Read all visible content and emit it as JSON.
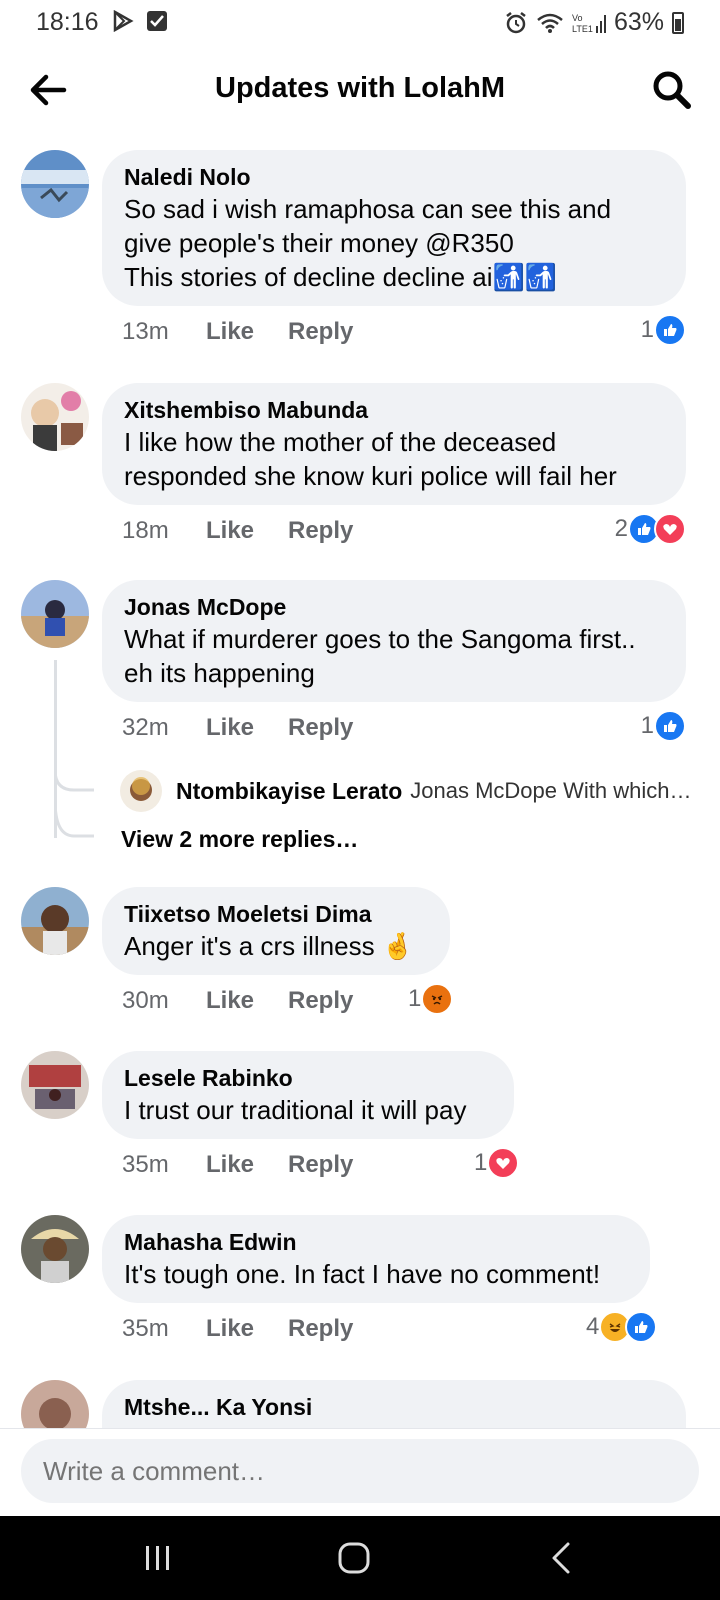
{
  "status_bar": {
    "time": "18:16",
    "battery": "63%",
    "net": "Vo\nLTE1"
  },
  "app_bar": {
    "title": "Updates with LolahM"
  },
  "comments": [
    {
      "name": "Naledi Nolo",
      "text": "So sad i wish ramaphosa can see this  and give people's their money @R350\nThis stories of decline decline ai🚮🚮",
      "time": "13m",
      "like": "Like",
      "reply": "Reply",
      "reaction_count": "1",
      "reactions": [
        "like-icon"
      ]
    },
    {
      "name": "Xitshembiso Mabunda",
      "text": "I like how the mother of the deceased responded she know kuri police will fail her",
      "time": "18m",
      "like": "Like",
      "reply": "Reply",
      "reaction_count": "2",
      "reactions": [
        "like-icon",
        "love-icon"
      ]
    },
    {
      "name": "Jonas McDope",
      "text": "What if murderer goes to the Sangoma first.. eh its happening",
      "time": "32m",
      "like": "Like",
      "reply": "Reply",
      "reaction_count": "1",
      "reactions": [
        "like-icon"
      ]
    },
    {
      "name": "Tiixetso Moeletsi Dima",
      "text": "Anger it's a crs illness 🤞",
      "time": "30m",
      "like": "Like",
      "reply": "Reply",
      "reaction_count": "1",
      "reactions": [
        "angry-icon"
      ]
    },
    {
      "name": "Lesele Rabinko",
      "text": "I trust our traditional it will pay",
      "time": "35m",
      "like": "Like",
      "reply": "Reply",
      "reaction_count": "1",
      "reactions": [
        "love-icon"
      ]
    },
    {
      "name": "Mahasha Edwin",
      "text": "It's tough one. In fact I have no comment!",
      "time": "35m",
      "like": "Like",
      "reply": "Reply",
      "reaction_count": "4",
      "reactions": [
        "haha-icon",
        "like-icon"
      ]
    }
  ],
  "reply_preview": {
    "name": "Ntombikayise Lerato",
    "text": "Jonas McDope With which…"
  },
  "view_more": "View 2 more replies…",
  "partial_comment": {
    "name": "Mtshe... Ka Yonsi"
  },
  "composer": {
    "placeholder": "Write a comment…"
  },
  "colors": {
    "accent": "#1877f2",
    "bubble": "#f0f2f5",
    "love": "#f33e58",
    "angry": "#e9710f",
    "haha": "#f7b125"
  }
}
